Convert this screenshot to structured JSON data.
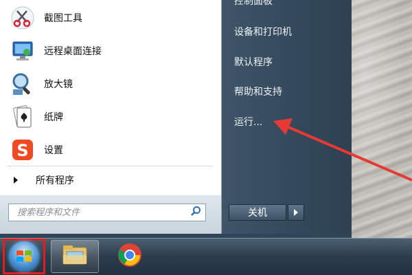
{
  "start_menu": {
    "programs": [
      {
        "label": "截图工具",
        "icon": "snipping-tool-icon"
      },
      {
        "label": "远程桌面连接",
        "icon": "remote-desktop-icon"
      },
      {
        "label": "放大镜",
        "icon": "magnifier-icon"
      },
      {
        "label": "纸牌",
        "icon": "solitaire-icon"
      },
      {
        "label": "设置",
        "icon": "sogou-s-icon"
      }
    ],
    "all_programs_label": "所有程序",
    "search_placeholder": "搜索程序和文件",
    "right_items": [
      {
        "label": "控制面板"
      },
      {
        "label": "设备和打印机"
      },
      {
        "label": "默认程序"
      },
      {
        "label": "帮助和支持"
      },
      {
        "label": "运行..."
      }
    ],
    "shutdown_label": "关机"
  },
  "taskbar": {
    "start_icon": "windows-start-icon",
    "pinned": [
      {
        "icon": "file-explorer-icon"
      },
      {
        "icon": "chrome-icon"
      }
    ]
  },
  "colors": {
    "annotation": "#e83a34",
    "start_highlight": "#e02020"
  }
}
